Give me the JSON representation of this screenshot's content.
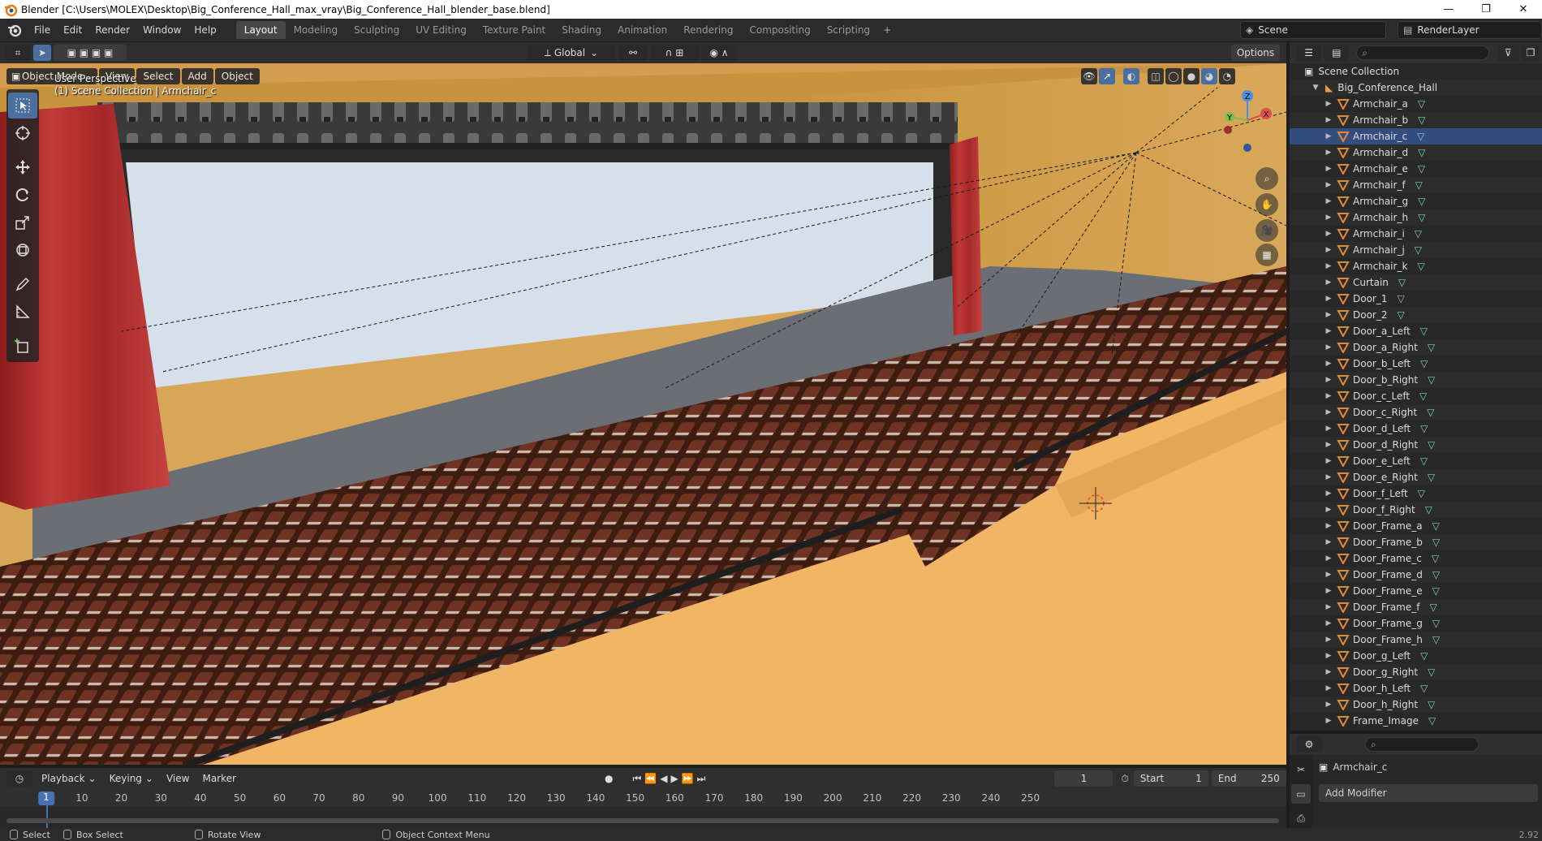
{
  "window": {
    "title": "Blender [C:\\Users\\MOLEX\\Desktop\\Big_Conference_Hall_max_vray\\Big_Conference_Hall_blender_base.blend]",
    "minimize": "—",
    "maximize": "❐",
    "close": "✕"
  },
  "menu": [
    "File",
    "Edit",
    "Render",
    "Window",
    "Help"
  ],
  "workspaces": [
    "Layout",
    "Modeling",
    "Sculpting",
    "UV Editing",
    "Texture Paint",
    "Shading",
    "Animation",
    "Rendering",
    "Compositing",
    "Scripting"
  ],
  "active_workspace": "Layout",
  "workspace_add": "+",
  "scene": {
    "name": "Scene",
    "render_layer": "RenderLayer"
  },
  "viewport": {
    "transform_orientation": "Global",
    "options_label": "Options",
    "mode": "Object Mode",
    "menus": [
      "View",
      "Select",
      "Add",
      "Object"
    ],
    "perspective": "User Perspective",
    "context": "(1) Scene Collection | Armchair_c",
    "axis_labels": {
      "x": "X",
      "y": "Y",
      "z": "Z"
    }
  },
  "timeline": {
    "menus": [
      "Playback",
      "Keying",
      "View",
      "Marker"
    ],
    "current_frame": "1",
    "start_label": "Start",
    "start": "1",
    "end_label": "End",
    "end": "250",
    "ticks": [
      "10",
      "20",
      "30",
      "40",
      "50",
      "60",
      "70",
      "80",
      "90",
      "100",
      "110",
      "120",
      "130",
      "140",
      "150",
      "160",
      "170",
      "180",
      "190",
      "200",
      "210",
      "220",
      "230",
      "240",
      "250"
    ]
  },
  "statusbar": {
    "select": "Select",
    "box_select": "Box Select",
    "rotate_view": "Rotate View",
    "context_menu": "Object Context Menu",
    "version": "2.92"
  },
  "outliner": {
    "root": "Scene Collection",
    "collection": "Big_Conference_Hall",
    "selected": "Armchair_c",
    "items": [
      "Armchair_a",
      "Armchair_b",
      "Armchair_c",
      "Armchair_d",
      "Armchair_e",
      "Armchair_f",
      "Armchair_g",
      "Armchair_h",
      "Armchair_i",
      "Armchair_j",
      "Armchair_k",
      "Curtain",
      "Door_1",
      "Door_2",
      "Door_a_Left",
      "Door_a_Right",
      "Door_b_Left",
      "Door_b_Right",
      "Door_c_Left",
      "Door_c_Right",
      "Door_d_Left",
      "Door_d_Right",
      "Door_e_Left",
      "Door_e_Right",
      "Door_f_Left",
      "Door_f_Right",
      "Door_Frame_a",
      "Door_Frame_b",
      "Door_Frame_c",
      "Door_Frame_d",
      "Door_Frame_e",
      "Door_Frame_f",
      "Door_Frame_g",
      "Door_Frame_h",
      "Door_g_Left",
      "Door_g_Right",
      "Door_h_Left",
      "Door_h_Right",
      "Frame_Image"
    ]
  },
  "properties": {
    "object_name": "Armchair_c",
    "add_modifier": "Add Modifier"
  },
  "colors": {
    "accent": "#4772b3",
    "object_orange": "#e08a3c",
    "mesh_teal": "#7bd6c0",
    "selection": "#334d80"
  }
}
